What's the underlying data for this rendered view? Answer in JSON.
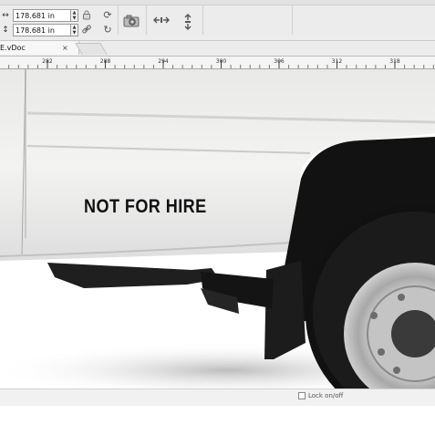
{
  "toolbar": {
    "width_value": "178.681 in",
    "height_value": "178.681 in",
    "width_icon": "width-arrows-icon",
    "height_icon": "height-arrows-icon",
    "lock_icon": "lock-icon",
    "link_icon": "link-icon",
    "rotate_cw_icon": "rotate-clockwise-icon",
    "rotate_refresh_icon": "refresh-icon",
    "camera_icon": "camera-icon",
    "flip_horizontal_icon": "flip-horizontal-icon",
    "flip_vertical_icon": "flip-vertical-icon"
  },
  "tabs": [
    {
      "label": "E.vDoc",
      "close": "×"
    }
  ],
  "ruler": {
    "ticks": [
      "282",
      "288",
      "294",
      "300",
      "306",
      "312",
      "318"
    ]
  },
  "canvas": {
    "decal_text": "NOT FOR HIRE"
  },
  "status": {
    "lock_label": "Lock on/off"
  },
  "colors": {
    "toolbar_bg": "#ececec",
    "ruler_bg": "#f4f4f4",
    "canvas_bg": "#ffffff",
    "decal_text": "#111111"
  }
}
